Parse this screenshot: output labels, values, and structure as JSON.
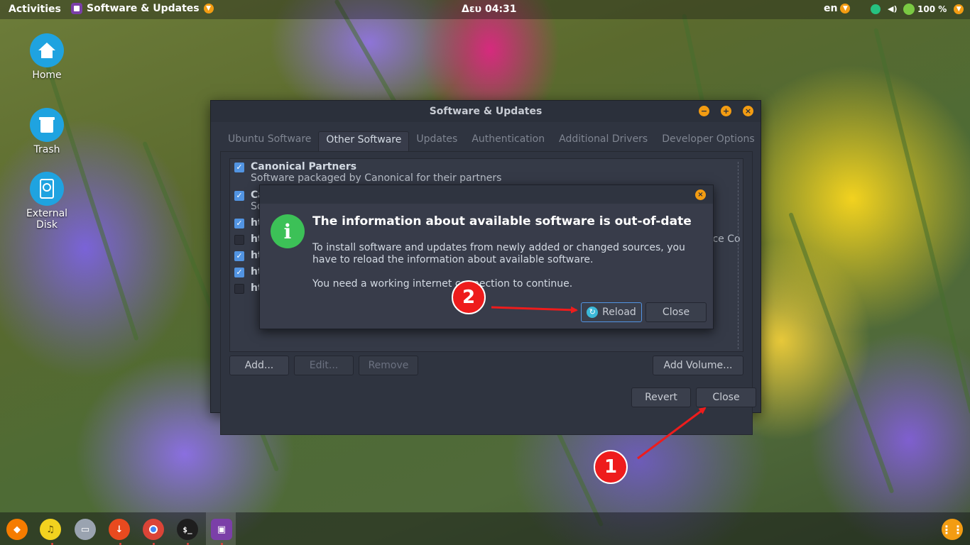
{
  "topbar": {
    "activities": "Activities",
    "app_name": "Software & Updates",
    "clock": "Δευ 04:31",
    "language": "en",
    "battery": "100 %"
  },
  "desktop": {
    "icons": [
      {
        "label": "Home"
      },
      {
        "label": "Trash"
      },
      {
        "label": "External Disk"
      }
    ]
  },
  "window": {
    "title": "Software & Updates",
    "tabs": [
      {
        "label": "Ubuntu Software"
      },
      {
        "label": "Other Software"
      },
      {
        "label": "Updates"
      },
      {
        "label": "Authentication"
      },
      {
        "label": "Additional Drivers"
      },
      {
        "label": "Developer Options"
      }
    ],
    "active_tab": "Other Software",
    "sources": [
      {
        "checked": true,
        "title": "Canonical Partners",
        "subtitle": "Software packaged by Canonical for their partners"
      },
      {
        "checked": true,
        "title": "Ca",
        "subtitle": "So"
      },
      {
        "checked": true,
        "title": "ht",
        "subtitle": ""
      },
      {
        "checked": false,
        "title": "ht",
        "subtitle": ""
      },
      {
        "checked": true,
        "title": "ht",
        "subtitle": ""
      },
      {
        "checked": true,
        "title": "ht",
        "subtitle": ""
      },
      {
        "checked": false,
        "title": "ht",
        "subtitle": ""
      }
    ],
    "source_overflow_text": "rce Co",
    "buttons": {
      "add": "Add...",
      "edit": "Edit...",
      "remove": "Remove",
      "add_volume": "Add Volume...",
      "revert": "Revert",
      "close": "Close"
    }
  },
  "dialog": {
    "heading": "The information about available software is out-of-date",
    "body": "To install software and updates from newly added or changed sources, you have to reload the information about available software.",
    "body2": "You need a working internet connection to continue.",
    "reload": "Reload",
    "close": "Close"
  },
  "annotations": {
    "badge1": "1",
    "badge2": "2",
    "color": "#ee1c1c"
  },
  "dock": {
    "items": [
      "firefox-icon",
      "music-icon",
      "files-icon",
      "downloader-icon",
      "chrome-icon",
      "terminal-icon",
      "software-updates-icon"
    ],
    "terminal_label": "$_"
  }
}
